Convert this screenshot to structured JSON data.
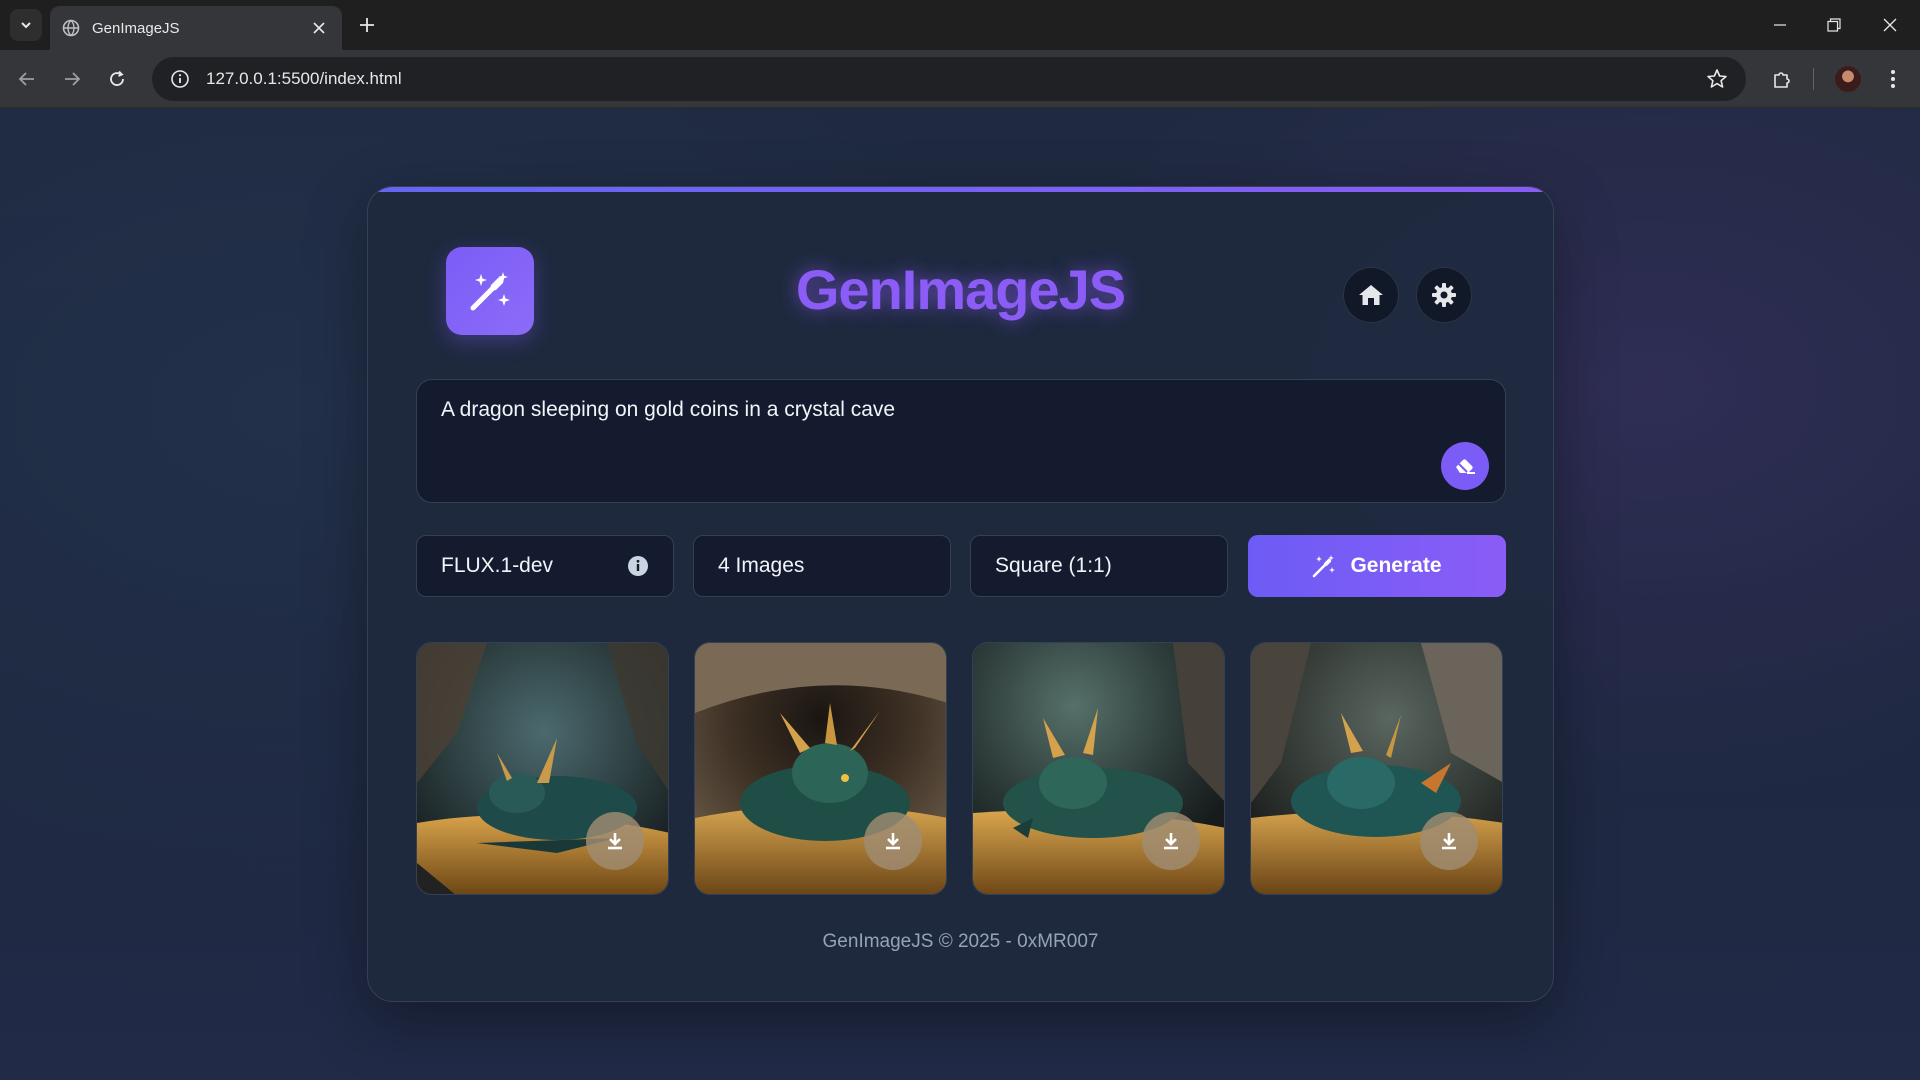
{
  "browser": {
    "tab_title": "GenImageJS",
    "url": "127.0.0.1:5500/index.html"
  },
  "app": {
    "title": "GenImageJS",
    "prompt_value": "A dragon sleeping on gold coins in a crystal cave",
    "model": "FLUX.1-dev",
    "image_count": "4 Images",
    "aspect_ratio": "Square (1:1)",
    "generate_label": "Generate",
    "footer": "GenImageJS © 2025 - 0xMR007"
  },
  "theme": {
    "accent": "#8b5cf6",
    "background": "#1e2840",
    "card": "#1e293e"
  },
  "icons": {
    "logo": "magic-wand-sparkles-icon",
    "home": "home-icon",
    "settings": "gear-icon",
    "prompt_action": "eraser-icon",
    "info": "info-icon",
    "download": "download-icon"
  },
  "images": [
    {
      "alt": "Dragon sleeping on gold coins 1"
    },
    {
      "alt": "Dragon sleeping on gold coins 2"
    },
    {
      "alt": "Dragon sleeping on gold coins 3"
    },
    {
      "alt": "Dragon sleeping on gold coins 4"
    }
  ]
}
